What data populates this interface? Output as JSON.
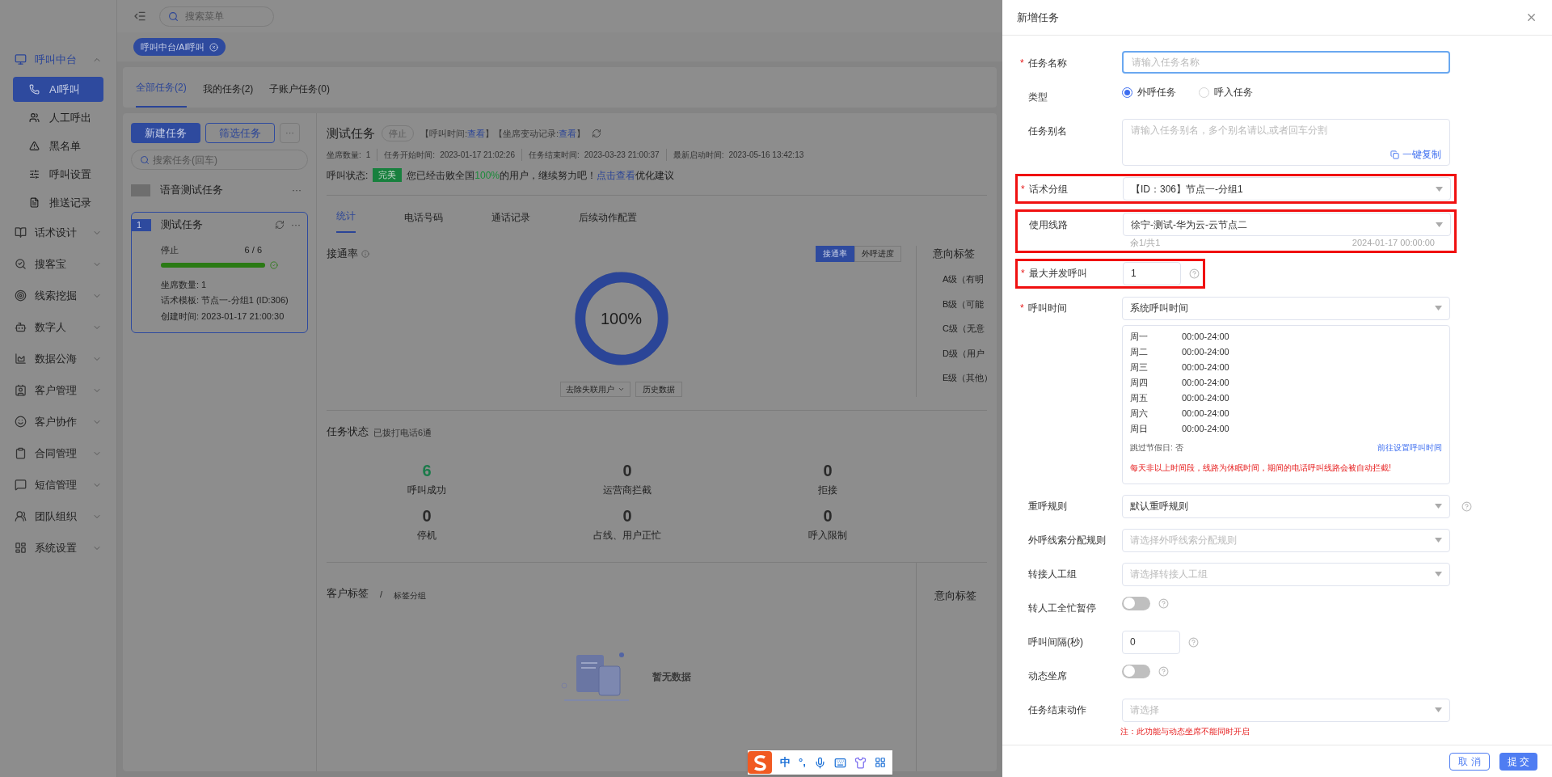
{
  "top_bar": {
    "search_placeholder": "搜索菜单"
  },
  "breadcrumb_tag": {
    "label": "呼叫中台/AI呼叫"
  },
  "sidebar": {
    "items": [
      {
        "label": "呼叫中台",
        "expanded": true,
        "selected": true,
        "children": [
          {
            "label": "AI呼叫",
            "selected": true
          },
          {
            "label": "人工呼出",
            "selected": false
          },
          {
            "label": "黑名单",
            "selected": false
          },
          {
            "label": "呼叫设置",
            "selected": false
          },
          {
            "label": "推送记录",
            "selected": false
          }
        ]
      },
      {
        "label": "话术设计",
        "expanded": false,
        "selected": false
      },
      {
        "label": "搜客宝",
        "expanded": false,
        "selected": false
      },
      {
        "label": "线索挖掘",
        "expanded": false,
        "selected": false
      },
      {
        "label": "数字人",
        "expanded": false,
        "selected": false
      },
      {
        "label": "数据公海",
        "expanded": false,
        "selected": false
      },
      {
        "label": "客户管理",
        "expanded": false,
        "selected": false
      },
      {
        "label": "客户协作",
        "expanded": false,
        "selected": false
      },
      {
        "label": "合同管理",
        "expanded": false,
        "selected": false
      },
      {
        "label": "短信管理",
        "expanded": false,
        "selected": false
      },
      {
        "label": "团队组织",
        "expanded": false,
        "selected": false
      },
      {
        "label": "系统设置",
        "expanded": false,
        "selected": false
      }
    ]
  },
  "task_tabs": [
    {
      "label": "全部任务(2)",
      "selected": true
    },
    {
      "label": "我的任务(2)",
      "selected": false
    },
    {
      "label": "子账户任务(0)",
      "selected": false
    }
  ],
  "task_list": {
    "primary_button": "新建任务",
    "filter_button": "筛选任务",
    "more": "···",
    "search_placeholder": "搜索任务(回车)",
    "tasks": [
      {
        "name": "语音测试任务",
        "selected": false,
        "more": "···"
      },
      {
        "index": "1",
        "name": "测试任务",
        "selected": true,
        "more": "···",
        "status": "停止",
        "progress": "6 / 6",
        "level": 1,
        "details": [
          "坐席数量: 1",
          "话术模板: 节点一-分组1 (ID:306)",
          "创建时间: 2023-01-17 21:00:30"
        ]
      }
    ]
  },
  "detail": {
    "title": "测试任务",
    "status": "停止",
    "links": [
      {
        "prefix": "【呼叫时间: ",
        "link": "查看",
        "suffix": "】"
      },
      {
        "prefix": "【坐席变动记录: ",
        "link": "查看",
        "suffix": "】"
      }
    ],
    "meta": [
      {
        "label": "坐席数量:",
        "value": "1"
      },
      {
        "label": "任务开始时间:",
        "value": "2023-01-17 21:02:26"
      },
      {
        "label": "任务结束时间:",
        "value": "2023-03-23 21:00:37"
      },
      {
        "label": "最新启动时间:",
        "value": "2023-05-16 13:42:13"
      }
    ],
    "call_status": {
      "label": "呼叫状态:",
      "badge": "完美",
      "before": "您已经击败全国",
      "highlight": "100%",
      "after": "的用户，继续努力吧！",
      "link": "点击查看",
      "tail": "优化建议"
    },
    "sub_tabs": [
      {
        "label": "统计",
        "selected": true
      },
      {
        "label": "电话号码",
        "selected": false
      },
      {
        "label": "通话记录",
        "selected": false
      },
      {
        "label": "后续动作配置",
        "selected": false
      }
    ],
    "connect_rate": {
      "title": "接通率",
      "toggle": [
        {
          "label": "接通率",
          "selected": true
        },
        {
          "label": "外呼进度",
          "selected": false
        }
      ],
      "donut_label": "100%",
      "level": 1,
      "filter": "去除失联用户",
      "history_button": "历史数据"
    },
    "intent_tags": {
      "title": "意向标签",
      "items": [
        "A级（有明",
        "B级（可能",
        "C级（无意",
        "D级（用户",
        "E级（其他）"
      ]
    },
    "task_status": {
      "title": "任务状态",
      "subtitle": "已拨打电话6通",
      "stats": [
        {
          "value": "6",
          "label": "呼叫成功",
          "highlight": true
        },
        {
          "value": "0",
          "label": "运营商拦截",
          "highlight": false
        },
        {
          "value": "0",
          "label": "拒接",
          "highlight": false
        },
        {
          "value": "0",
          "label": "停机",
          "highlight": false
        },
        {
          "value": "0",
          "label": "占线、用户正忙",
          "highlight": false
        },
        {
          "value": "0",
          "label": "呼入限制",
          "highlight": false
        }
      ]
    },
    "customer_tags": {
      "title": "客户标签",
      "separator": "/",
      "subtitle": "标签分组",
      "empty": "暂无数据",
      "right_title": "意向标签"
    }
  },
  "drawer": {
    "title": "新增任务",
    "fields": [
      {
        "kind": "text",
        "label": "任务名称",
        "marker": "*",
        "highlighted": false,
        "help": false,
        "placeholder": "请输入任务名称",
        "focused": true
      },
      {
        "kind": "radio",
        "label": "类型",
        "highlighted": false,
        "help": false,
        "options": [
          {
            "label": "外呼任务",
            "selected": true
          },
          {
            "label": "呼入任务",
            "selected": false
          }
        ]
      },
      {
        "kind": "textarea",
        "label": "任务别名",
        "highlighted": false,
        "help": false,
        "placeholder": "请输入任务别名，多个别名请以,或者回车分割",
        "action": "一键复制"
      },
      {
        "kind": "select",
        "label": "话术分组",
        "marker": "*",
        "highlighted": true,
        "value": "【ID：306】节点一-分组1",
        "help": false
      },
      {
        "kind": "select",
        "label": "使用线路",
        "highlighted": true,
        "value": "徐宁-测试-华为云-云节点二",
        "help": false,
        "sub_left": "余1/共1",
        "sub_right": "2024-01-17 00:00:00"
      },
      {
        "kind": "number",
        "label": "最大并发呼叫",
        "marker": "*",
        "highlighted": true,
        "value": "1",
        "help": true
      },
      {
        "kind": "schedule",
        "label": "呼叫时间",
        "marker": "*",
        "highlighted": false,
        "help": false,
        "value": "系统呼叫时间",
        "days": [
          {
            "day": "周一",
            "time": "00:00-24:00"
          },
          {
            "day": "周二",
            "time": "00:00-24:00"
          },
          {
            "day": "周三",
            "time": "00:00-24:00"
          },
          {
            "day": "周四",
            "time": "00:00-24:00"
          },
          {
            "day": "周五",
            "time": "00:00-24:00"
          },
          {
            "day": "周六",
            "time": "00:00-24:00"
          },
          {
            "day": "周日",
            "time": "00:00-24:00"
          }
        ],
        "holiday": "跳过节假日: 否",
        "link": "前往设置呼叫时间",
        "warning": "每天非以上时间段，线路为休眠时间，期间的电话呼叫线路会被自动拦截!"
      },
      {
        "kind": "select",
        "label": "重呼规则",
        "highlighted": false,
        "value": "默认重呼规则",
        "help": true
      },
      {
        "kind": "select",
        "label": "外呼线索分配规则",
        "highlighted": false,
        "placeholder": "请选择外呼线索分配规则",
        "help": false
      },
      {
        "kind": "select",
        "label": "转接人工组",
        "highlighted": false,
        "placeholder": "请选择转接人工组",
        "help": false
      },
      {
        "kind": "switch",
        "label": "转人工全忙暂停",
        "highlighted": false,
        "on": false,
        "help": true
      },
      {
        "kind": "number",
        "label": "呼叫间隔(秒)",
        "highlighted": false,
        "value": "0",
        "help": true
      },
      {
        "kind": "switch",
        "label": "动态坐席",
        "highlighted": false,
        "on": false,
        "help": true
      },
      {
        "kind": "select",
        "label": "任务结束动作",
        "highlighted": false,
        "placeholder": "请选择",
        "help": false,
        "note": "注：此功能与动态坐席不能同时开启"
      }
    ],
    "buttons": [
      {
        "label": "取 消",
        "kind": "secondary"
      },
      {
        "label": "提 交",
        "kind": "primary"
      }
    ]
  },
  "ime_bar": {
    "items": [
      {
        "kind": "logo"
      },
      {
        "kind": "text",
        "label": "中"
      },
      {
        "kind": "text",
        "label": "°,"
      },
      {
        "kind": "mic"
      },
      {
        "kind": "keyboard"
      },
      {
        "kind": "skin"
      },
      {
        "kind": "apps"
      }
    ]
  }
}
